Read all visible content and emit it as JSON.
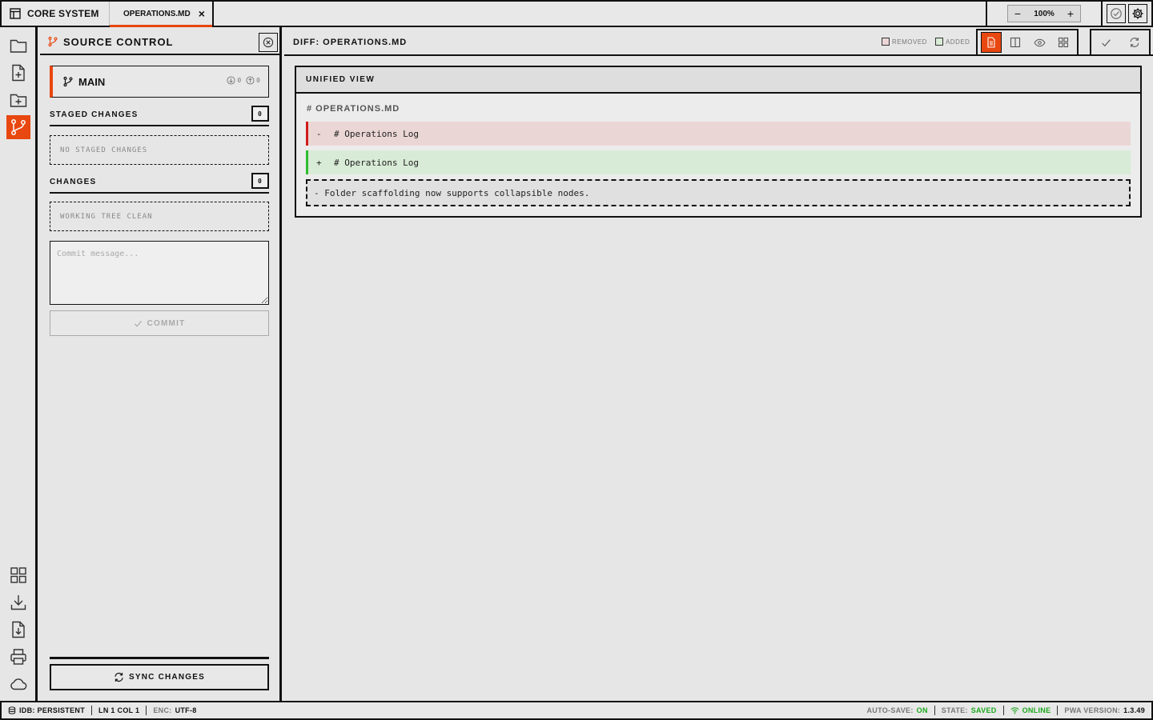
{
  "app": {
    "title": "CORE SYSTEM"
  },
  "tabs": [
    {
      "label": "OPERATIONS.MD",
      "active": true
    }
  ],
  "zoom": {
    "value": "100%",
    "minus": "−",
    "plus": "+"
  },
  "activity_bar": {
    "items": [
      {
        "name": "explorer",
        "icon": "folder-icon",
        "active": false
      },
      {
        "name": "new-file",
        "icon": "file-plus-icon",
        "active": false
      },
      {
        "name": "new-folder",
        "icon": "folder-plus-icon",
        "active": false
      },
      {
        "name": "source-control",
        "icon": "git-branch-icon",
        "active": true
      }
    ],
    "bottom_items": [
      {
        "name": "apps",
        "icon": "grid-icon"
      },
      {
        "name": "download",
        "icon": "download-icon"
      },
      {
        "name": "import-file",
        "icon": "file-download-icon"
      },
      {
        "name": "print",
        "icon": "printer-icon"
      },
      {
        "name": "cloud",
        "icon": "cloud-icon"
      }
    ]
  },
  "source_control": {
    "title": "SOURCE CONTROL",
    "branch": {
      "name": "MAIN",
      "incoming": "0",
      "outgoing": "0"
    },
    "staged": {
      "title": "STAGED CHANGES",
      "count": "0",
      "empty": "NO STAGED CHANGES"
    },
    "changes": {
      "title": "CHANGES",
      "count": "0",
      "empty": "WORKING TREE CLEAN"
    },
    "commit_placeholder": "Commit message...",
    "commit_label": "COMMIT",
    "sync_label": "SYNC CHANGES"
  },
  "diff": {
    "title": "DIFF: OPERATIONS.MD",
    "legend": {
      "removed": "REMOVED",
      "added": "ADDED"
    },
    "view_label": "UNIFIED VIEW",
    "filename": "# OPERATIONS.MD",
    "lines": [
      {
        "type": "removed",
        "sign": "-",
        "text": "# Operations Log"
      },
      {
        "type": "added",
        "sign": "+",
        "text": "# Operations Log"
      }
    ],
    "note": "- Folder scaffolding now supports collapsible nodes."
  },
  "status": {
    "storage": "IDB: PERSISTENT",
    "position": "LN 1 COL 1",
    "encoding_label": "ENC:",
    "encoding": "UTF-8",
    "autosave_label": "AUTO-SAVE:",
    "autosave": "ON",
    "state_label": "STATE:",
    "state": "SAVED",
    "network": "ONLINE",
    "version_label": "PWA VERSION:",
    "version": "1.3.49"
  },
  "colors": {
    "accent": "#e8470f",
    "removed_bg": "#ebd6d6",
    "removed_bar": "#d01c1c",
    "added_bg": "#d8ebd6",
    "added_bar": "#2ebd2e",
    "ok_text": "#1ca71c"
  }
}
